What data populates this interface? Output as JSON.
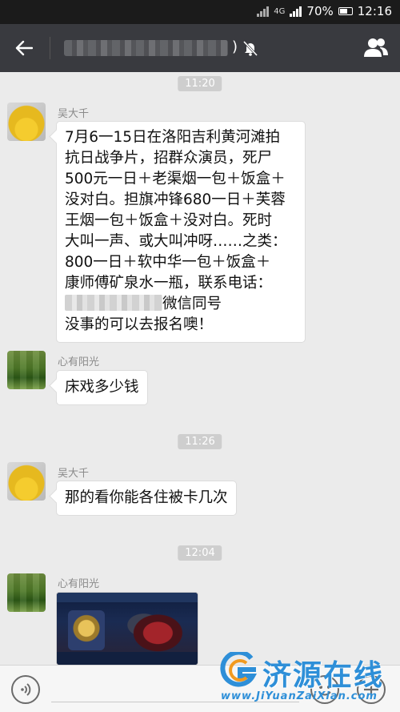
{
  "status_bar": {
    "network": "4G",
    "battery": "70%",
    "time": "12:16"
  },
  "header": {
    "title_suffix": ")",
    "icons": {
      "back": "arrow-left-icon",
      "mute": "bell-off-icon",
      "contacts": "people-icon"
    }
  },
  "messages": [
    {
      "type": "time",
      "text": "11:20"
    },
    {
      "type": "text",
      "sender": "吴大千",
      "avatar": "yellow-face-avatar",
      "lines": [
        "7月6一15日在洛阳吉利黄河滩拍",
        "抗日战争片，招群众演员，死尸",
        "500元一日＋老渠烟一包＋饭盒＋",
        "没对白。担旗冲锋680一日＋芙蓉",
        "王烟一包＋饭盒＋没对白。死时",
        "大叫一声、或大叫冲呀……之类：",
        "800一日＋软中华一包＋饭盒＋",
        "康师傅矿泉水一瓶，联系电话：",
        "微信同号",
        "没事的可以去报名噢！"
      ]
    },
    {
      "type": "text",
      "sender": "心有阳光",
      "avatar": "green-field-avatar",
      "text": "床戏多少钱"
    },
    {
      "type": "time",
      "text": "11:26"
    },
    {
      "type": "text",
      "sender": "吴大千",
      "avatar": "yellow-face-avatar",
      "text": "那的看你能各住被卡几次"
    },
    {
      "type": "time",
      "text": "12:04"
    },
    {
      "type": "image",
      "sender": "心有阳光",
      "avatar": "green-field-avatar",
      "image": "game-screenshot-thumbnail"
    }
  ],
  "bottom_bar": {
    "icons": {
      "voice": "voice-icon",
      "emoji": "emoji-icon",
      "more": "plus-icon"
    }
  },
  "watermark": {
    "name": "济源在线",
    "url": "www.JiYuanZaiXian.com"
  }
}
